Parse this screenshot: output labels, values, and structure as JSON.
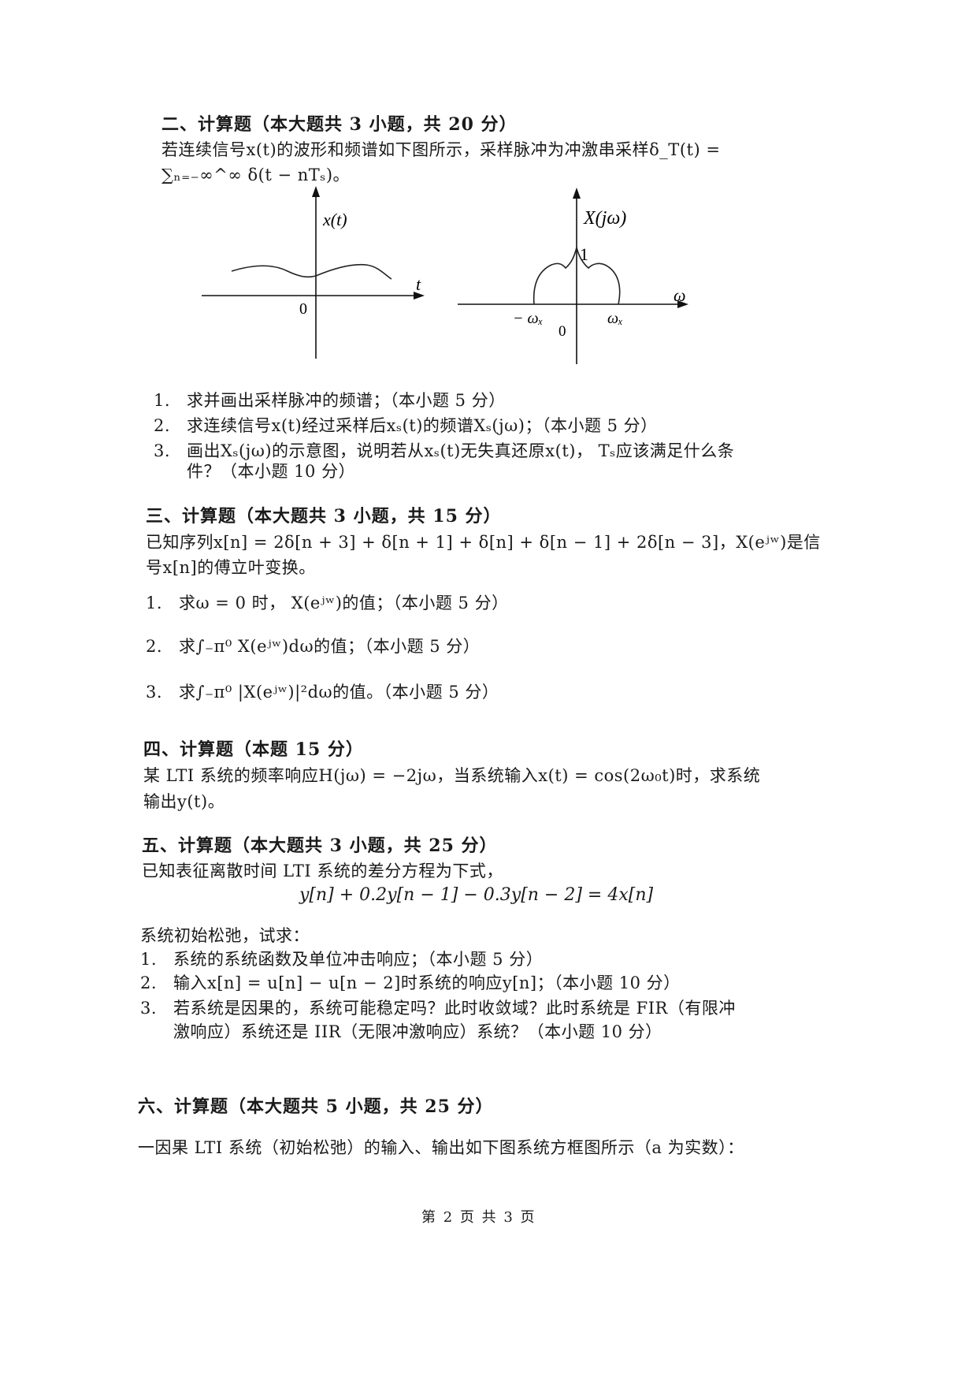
{
  "section2": {
    "heading": "二、计算题（本大题共 3 小题，共 20 分）",
    "intro_line1": "若连续信号x(t)的波形和频谱如下图所示，采样脉冲为冲激串采样δ_T(t) =",
    "intro_line2": "∑ₙ₌₋∞^∞ δ(t − nTₛ)。",
    "figure_left": {
      "ylabel": "x(t)",
      "xlabel": "t",
      "origin": "0"
    },
    "figure_right": {
      "ylabel": "X(jω)",
      "xlabel": "ω",
      "peak": "1",
      "neg_tick": "− ωₓ",
      "pos_tick": "ωₓ",
      "origin": "0"
    },
    "items": [
      {
        "num": "1.",
        "text": "求并画出采样脉冲的频谱；（本小题 5 分）"
      },
      {
        "num": "2.",
        "text": "求连续信号x(t)经过采样后xₛ(t)的频谱Xₛ(jω)；（本小题 5 分）"
      },
      {
        "num": "3.",
        "text": "画出Xₛ(jω)的示意图，说明若从xₛ(t)无失真还原x(t)， Tₛ应该满足什么条"
      },
      {
        "num": "",
        "text": "件？（本小题 10 分）"
      }
    ]
  },
  "section3": {
    "heading": "三、计算题（本大题共 3 小题，共 15 分）",
    "intro_line1": "已知序列x[n] = 2δ[n + 3] + δ[n + 1] + δ[n] + δ[n − 1] + 2δ[n − 3]，X(eʲʷ)是信",
    "intro_line2": "号x[n]的傅立叶变换。",
    "items": [
      {
        "num": "1.",
        "text": "求ω = 0 时， X(eʲʷ)的值；（本小题 5 分）"
      },
      {
        "num": "2.",
        "text": "求∫₋π⁰ X(eʲʷ)dω的值；（本小题 5 分）"
      },
      {
        "num": "3.",
        "text": "求∫₋π⁰ |X(eʲʷ)|²dω的值。（本小题 5 分）"
      }
    ]
  },
  "section4": {
    "heading": "四、计算题（本题 15 分）",
    "line1": "某 LTI 系统的频率响应H(jω) = −2jω，当系统输入x(t) = cos(2ω₀t)时，求系统",
    "line2": "输出y(t)。"
  },
  "section5": {
    "heading": "五、计算题（本大题共 3 小题，共 25 分）",
    "intro": "已知表征离散时间 LTI 系统的差分方程为下式，",
    "equation": "y[n] + 0.2y[n − 1] − 0.3y[n − 2] = 4x[n]",
    "condition": "系统初始松弛，试求：",
    "items": [
      {
        "num": "1.",
        "text": "系统的系统函数及单位冲击响应；（本小题 5 分）"
      },
      {
        "num": "2.",
        "text": "输入x[n] = u[n] − u[n − 2]时系统的响应y[n]；（本小题 10 分）"
      },
      {
        "num": "3.",
        "text": "若系统是因果的，系统可能稳定吗？此时收敛域？此时系统是 FIR（有限冲"
      },
      {
        "num": "",
        "text": "激响应）系统还是 IIR（无限冲激响应）系统？（本小题 10 分）"
      }
    ]
  },
  "section6": {
    "heading": "六、计算题（本大题共 5 小题，共 25 分）",
    "intro": "一因果 LTI 系统（初始松弛）的输入、输出如下图系统方框图所示（a 为实数）："
  },
  "footer": {
    "page": "第 2 页 共 3 页"
  }
}
